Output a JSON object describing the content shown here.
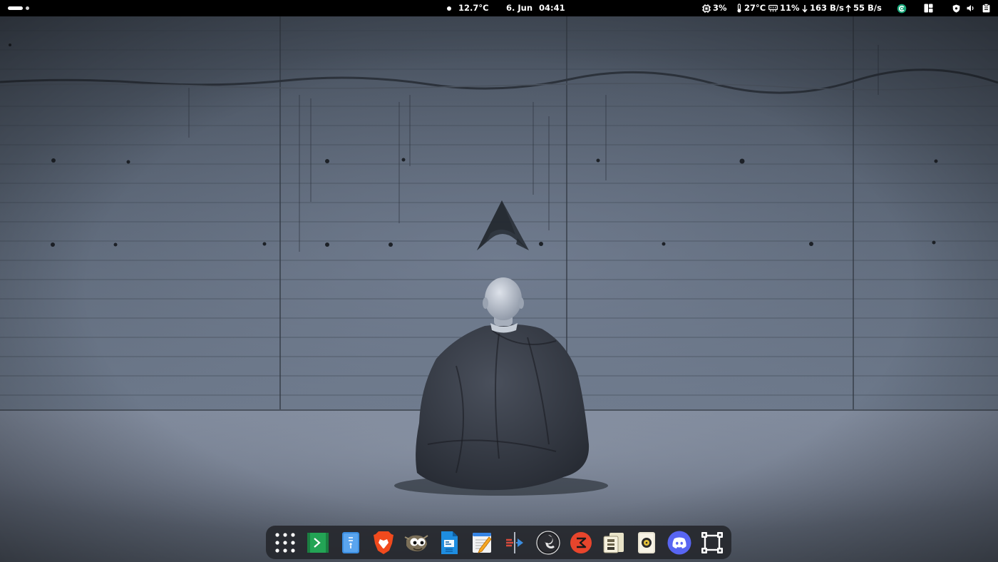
{
  "topbar": {
    "weather": "12.7°C",
    "date": "6. Jun",
    "time": "04:41",
    "cpu": "3%",
    "temperature": "27°C",
    "memory": "11%",
    "download": "163 B/s",
    "upload": "55 B/s"
  },
  "dock": {
    "apps": [
      {
        "name": "show-apps-grid",
        "icon": "app-grid-icon"
      },
      {
        "name": "terminal",
        "icon": "terminal-icon"
      },
      {
        "name": "files",
        "icon": "file-manager-icon"
      },
      {
        "name": "brave-browser",
        "icon": "brave-lion-icon"
      },
      {
        "name": "gimp",
        "icon": "gimp-icon"
      },
      {
        "name": "document-viewer",
        "icon": "document-icon"
      },
      {
        "name": "text-editor",
        "icon": "text-editor-icon"
      },
      {
        "name": "meld",
        "icon": "diff-compare-icon"
      },
      {
        "name": "obs-studio",
        "icon": "obs-icon"
      },
      {
        "name": "typora",
        "icon": "red-circle-app-icon"
      },
      {
        "name": "archive-manager",
        "icon": "archive-icon"
      },
      {
        "name": "rhythmbox",
        "icon": "music-player-icon"
      },
      {
        "name": "discord",
        "icon": "discord-icon"
      },
      {
        "name": "window-manager",
        "icon": "window-frame-icon"
      }
    ]
  },
  "colors": {
    "topbar": "#000000",
    "wall": "#5d6878",
    "floor": "#6e7888",
    "dock": "#26282e",
    "discord": "#5865f2",
    "brave": "#f14a1d",
    "terminal": "#23a455"
  }
}
